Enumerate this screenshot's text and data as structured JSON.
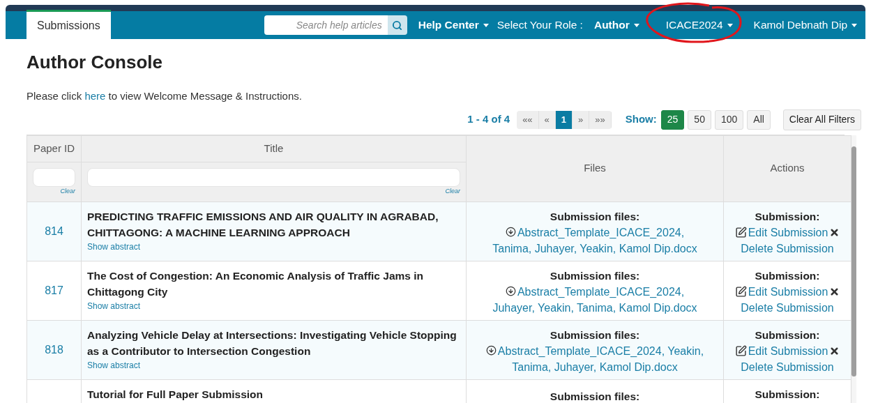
{
  "nav": {
    "tabs": [
      {
        "label": "Submissions",
        "selected": true
      }
    ],
    "search": {
      "placeholder": "Search help articles"
    },
    "help_menu": {
      "label": "Help Center"
    },
    "role_label": "Select Your Role :",
    "role_menu": {
      "label": "Author"
    },
    "conference_menu": {
      "label": "ICACE2024",
      "annotated": true
    },
    "user_menu": {
      "label": "Kamol Debnath Dip"
    }
  },
  "heading": "Author Console",
  "intro": {
    "before": "Please click ",
    "link": "here",
    "after": " to view Welcome Message & Instructions."
  },
  "pagination": {
    "range": "1 - 4 of 4",
    "pages": [
      {
        "label": "««",
        "selected": false
      },
      {
        "label": "«",
        "selected": false
      },
      {
        "label": "1",
        "selected": true
      },
      {
        "label": "»",
        "selected": false
      },
      {
        "label": "»»",
        "selected": false
      }
    ],
    "show_label": "Show:",
    "sizes": [
      {
        "label": "25",
        "selected": true
      },
      {
        "label": "50",
        "selected": false
      },
      {
        "label": "100",
        "selected": false
      },
      {
        "label": "All",
        "selected": false
      }
    ],
    "clear_filters": "Clear All Filters"
  },
  "table": {
    "columns": [
      {
        "label": "Paper ID",
        "clear": "Clear"
      },
      {
        "label": "Title",
        "clear": "Clear"
      },
      {
        "label": "Files"
      },
      {
        "label": "Actions"
      }
    ],
    "rows": [
      {
        "id": "814",
        "title": "PREDICTING TRAFFIC EMISSIONS AND AIR QUALITY IN AGRABAD, CHITTAGONG: A MACHINE LEARNING APPROACH",
        "abstract_link": "Show abstract",
        "files_label": "Submission files:",
        "file": "Abstract_Template_ICACE_2024, Tanima, Juhayer, Yeakin, Kamol Dip.docx",
        "actions_label": "Submission:",
        "edit": "Edit Submission",
        "delete": "Delete Submission"
      },
      {
        "id": "817",
        "title": "The Cost of Congestion: An Economic Analysis of Traffic Jams in Chittagong City",
        "abstract_link": "Show abstract",
        "files_label": "Submission files:",
        "file": "Abstract_Template_ICACE_2024, Juhayer, Yeakin, Tanima, Kamol Dip.docx",
        "actions_label": "Submission:",
        "edit": "Edit Submission",
        "delete": "Delete Submission"
      },
      {
        "id": "818",
        "title": "Analyzing Vehicle Delay at Intersections: Investigating Vehicle Stopping as a Contributor to Intersection Congestion",
        "abstract_link": "Show abstract",
        "files_label": "Submission files:",
        "file": "Abstract_Template_ICACE_2024, Yeakin, Tanima, Juhayer, Kamol Dip.docx",
        "actions_label": "Submission:",
        "edit": "Edit Submission",
        "delete": "Delete Submission"
      },
      {
        "title": "Tutorial for Full Paper Submission",
        "files_label": "Submission files:",
        "actions_label": "Submission:"
      }
    ]
  }
}
